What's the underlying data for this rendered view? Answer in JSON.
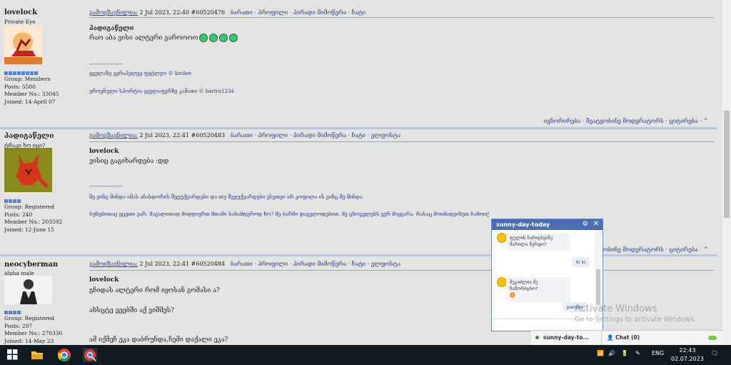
{
  "posts": [
    {
      "author": "lovelock",
      "title": "Private Eye",
      "group": "Group: Members",
      "posts": "Posts: 5500",
      "member_no": "Member No.: 33045",
      "joined": "Joined: 14-April 07",
      "header_link": "გამოგზავნილია:",
      "date": "2 Jul 2023, 22:40",
      "post_id": "#60520476",
      "actions": "ბარათი · პროფილი · პირადი მიმოწერა · ჩატი",
      "quote_author": "პადიგაწელი",
      "text": "რაო აბა ვისი ალტერი ვაროოოო",
      "dashes": "--------------------",
      "sig1": "ყველაზე ვერაპელეე ფეტლეო © kivilee",
      "sig2": "ეროვნული სპორტია ყველაფერზე კამათი © bartra1234",
      "footer": "იგნორირება · შეატყობინე მოდერატორს · ციტირება · ^"
    },
    {
      "author": "პადიგაწელი",
      "title": "ტრაკი ხო იცი?",
      "group": "Group: Registered",
      "posts": "Posts: 240",
      "member_no": "Member No.: 203592",
      "joined": "Joined: 12-June 15",
      "header_link": "გამოგზავნილია:",
      "date": "2 Jul 2023, 22:41",
      "post_id": "#60520483",
      "actions": "ბარათი · პროფილი · პირადი მიმოწერა · ჩატი · ელფოსტა",
      "quote_author": "lovelock",
      "text": "ვისიც გაგიხარდება :დდ",
      "dashes": "--------------------",
      "sig1": "მე ვინც მინდა იმას აჩასდორის შეეუქვარდები და თუ შეეუქვარდები ესეთვი არ კოფილა ის ვინც მე მინდა",
      "sig2": "ბუნებითაც ეცეთი ვარ, მაგალითად მიდდიერთ მთაში სანამდეროდ ხო? მე ბარში დაგელოდებით, მე ცხოველებს ვერ მიყვარა, რასაც მოიმადეიხეთ ჩამოიტანეთ შეჭამოთ, პაცალტა :bolt:",
      "footer": "იგნორირება · შეატყობინე მოდერატორს · ციტირება · ^"
    },
    {
      "author": "neocyberman",
      "title": "alpha male",
      "group": "Group: Registered",
      "posts": "Posts: 297",
      "member_no": "Member No.: 270336",
      "joined": "Joined: 14-May 23",
      "header_link": "გამოგზავნილია:",
      "date": "2 Jul 2023, 22:41",
      "post_id": "#60520484",
      "actions": "ბარათი · პროფილი · პირადი მიმოწერა · ჩატი · ელფოსტა",
      "quote_author": "lovelock",
      "text": "გჩიდას ალტერი რომ იყოსან გომასი ა?",
      "text2": "ახსცტე ეეებში აქ ვიშმეს?",
      "text3": "ამ იქმეჩ ეკა დაბრუნდა,ჩემი დაქალი ეკა?"
    }
  ],
  "chat": {
    "name": "sunny-day-today",
    "msg1": "ფულის ჩარიცხვაზე მარილა წერდი?",
    "reply1": "ki ki",
    "msg2": "შეგიძლია მე ჩამორიცხო?",
    "reply2": "pardon",
    "tab1": "sunny-day-to...",
    "tab2": "Chat (0)"
  },
  "watermark": {
    "line1": "Activate Windows",
    "line2": "Go to Settings to activate Windows."
  },
  "taskbar": {
    "lang": "ENG",
    "time": "22:43",
    "date": "02.07.2023"
  }
}
